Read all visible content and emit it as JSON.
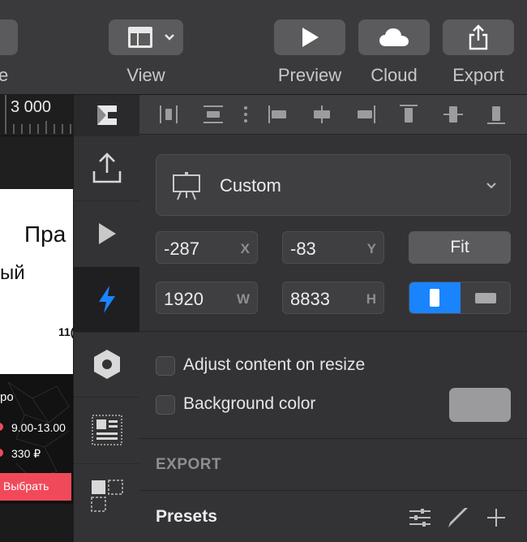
{
  "toolbar": {
    "left_label_partial": "e",
    "view_label": "View",
    "preview_label": "Preview",
    "cloud_label": "Cloud",
    "export_label": "Export"
  },
  "canvas": {
    "ruler_value": "3 000",
    "heading_partial": "Пра",
    "subheading_partial": "ый",
    "small_number_partial": "11(",
    "row1_partial": "ро",
    "row2_text": "9.00-13.00",
    "row3_text": "330 ₽",
    "cta_label": "Выбрать",
    "accent_color": "#f04a5a"
  },
  "inspector": {
    "preset_name": "Custom",
    "x_value": "-287",
    "x_label": "X",
    "y_value": "-83",
    "y_label": "Y",
    "fit_label": "Fit",
    "w_value": "1920",
    "w_label": "W",
    "h_value": "8833",
    "h_label": "H",
    "adjust_label": "Adjust content on resize",
    "bg_color_label": "Background color",
    "bg_swatch_color": "#9b9b9d",
    "export_header": "EXPORT",
    "presets_label": "Presets",
    "orientation_active_color": "#1a84ff"
  }
}
